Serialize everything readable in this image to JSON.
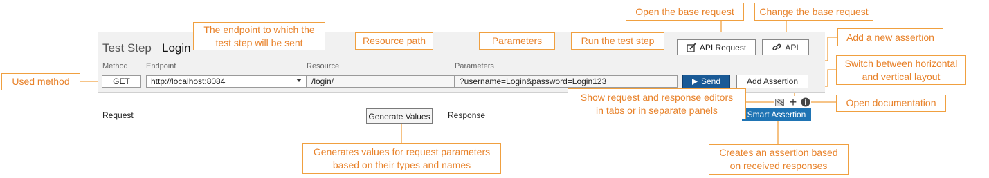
{
  "test_step": {
    "title_prefix": "Test Step",
    "title_name": "Login"
  },
  "labels": {
    "method": "Method",
    "endpoint": "Endpoint",
    "resource": "Resource",
    "parameters": "Parameters"
  },
  "values": {
    "method": "GET",
    "endpoint": "http://localhost:8084",
    "resource": "/login/",
    "parameters": "?username=Login&password=Login123"
  },
  "buttons": {
    "send": "Send",
    "add_assertion": "Add Assertion",
    "api_request": "API Request",
    "api": "API",
    "generate_values": "Generate Values",
    "smart_assertion": "Smart Assertion"
  },
  "editors": {
    "request": "Request",
    "response": "Response"
  },
  "callouts": {
    "open_base_request": "Open the base request",
    "change_base_request": "Change the base request",
    "endpoint_line1": "The endpoint to which the",
    "endpoint_line2": "test step will be sent",
    "resource_path": "Resource path",
    "parameters": "Parameters",
    "run_test_step": "Run the test step",
    "add_new_assertion": "Add a new assertion",
    "switch_layout_line1": "Switch between horizontal",
    "switch_layout_line2": "and vertical layout",
    "used_method": "Used method",
    "show_editors_line1": "Show request and response editors",
    "show_editors_line2": "in tabs or in separate panels",
    "open_documentation": "Open documentation",
    "generates_line1": "Generates values for request parameters",
    "generates_line2": "based on their types and names",
    "creates_line1": "Creates an assertion based",
    "creates_line2": "on received responses"
  },
  "icons": {
    "send": "play-icon",
    "api_request": "edit-icon",
    "api": "link-icon",
    "tabs_panels": "tabs-icon",
    "layout": "plus-icon",
    "documentation": "info-icon"
  },
  "colors": {
    "callout_accent": "#f0a040",
    "send_button": "#1a5a96",
    "smart_button": "#1f74b4"
  }
}
